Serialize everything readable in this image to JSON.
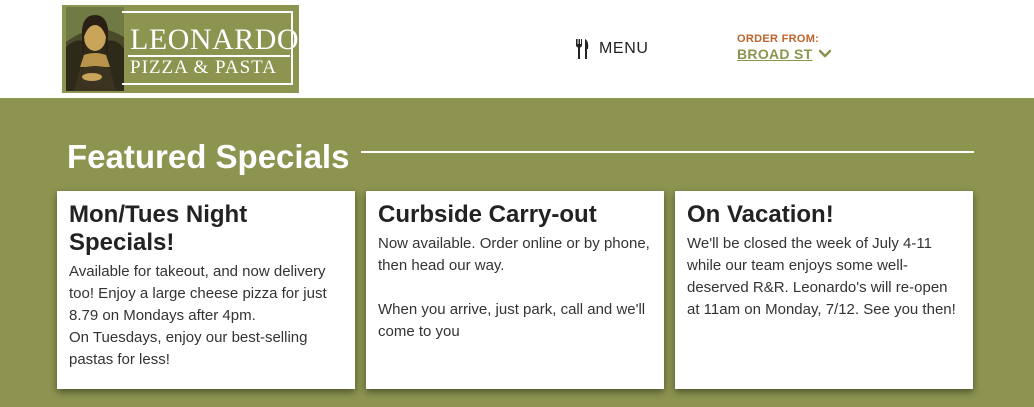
{
  "header": {
    "logo": {
      "title": "LEONARDO'S",
      "subtitle": "PIZZA & PASTA"
    },
    "menu": {
      "icon": "fork-knife-icon",
      "label": "MENU"
    },
    "order_from": {
      "label": "ORDER FROM:",
      "value": "BROAD ST",
      "icon": "chevron-down-icon"
    }
  },
  "specials": {
    "title": "Featured Specials",
    "cards": [
      {
        "title": "Mon/Tues Night Specials!",
        "body": "Available for takeout, and now delivery too!  Enjoy a large cheese pizza for just 8.79 on Mondays after 4pm.\nOn Tuesdays, enjoy our best-selling pastas for less!"
      },
      {
        "title": "Curbside Carry-out",
        "body": "Now available.  Order online or by phone, then head our way.\n\nWhen you arrive, just park, call and we'll come to you"
      },
      {
        "title": "On Vacation!",
        "body": "We'll be closed the week of July 4-11 while our team enjoys some well-deserved R&R. Leonardo's will re-open at 11am on Monday, 7/12.  See you then!"
      }
    ]
  },
  "colors": {
    "brand_olive": "#8d9450",
    "accent_orange": "#c0632b",
    "text_dark": "#222222"
  }
}
